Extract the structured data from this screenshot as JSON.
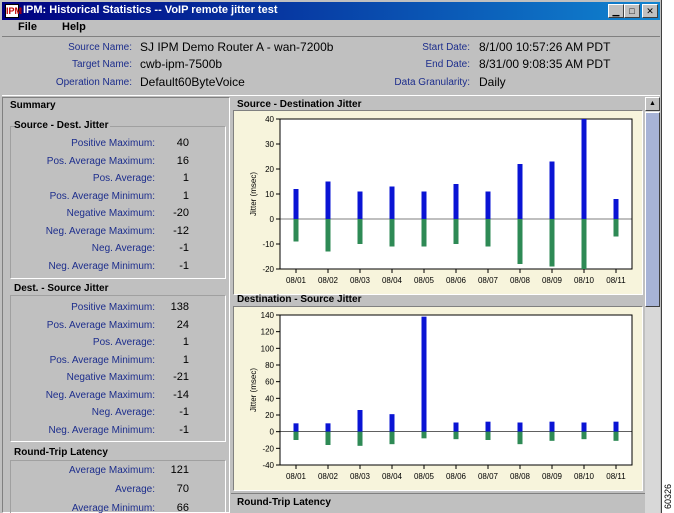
{
  "window": {
    "title": "IPM: Historical Statistics -- VoIP remote jitter test",
    "icon_text": "IPM",
    "controls": [
      "minimize-icon",
      "maximize-icon",
      "close-icon"
    ]
  },
  "menu": [
    {
      "label": "File"
    },
    {
      "label": "Help"
    }
  ],
  "info": {
    "source_name_label": "Source Name:",
    "source_name": "SJ IPM Demo Router A - wan-7200b",
    "target_name_label": "Target Name:",
    "target_name": "cwb-ipm-7500b",
    "operation_name_label": "Operation Name:",
    "operation_name": "Default60ByteVoice",
    "start_date_label": "Start Date:",
    "start_date": "8/1/00 10:57:26 AM PDT",
    "end_date_label": "End Date:",
    "end_date": "8/31/00 9:08:35 AM PDT",
    "granularity_label": "Data Granularity:",
    "granularity": "Daily"
  },
  "summary": {
    "title": "Summary",
    "groups": [
      {
        "title": "Source - Dest. Jitter",
        "rows": [
          {
            "label": "Positive Maximum:",
            "value": "40"
          },
          {
            "label": "Pos. Average Maximum:",
            "value": "16"
          },
          {
            "label": "Pos. Average:",
            "value": "1"
          },
          {
            "label": "Pos. Average Minimum:",
            "value": "1"
          },
          {
            "label": "Negative Maximum:",
            "value": "-20"
          },
          {
            "label": "Neg. Average Maximum:",
            "value": "-12"
          },
          {
            "label": "Neg. Average:",
            "value": "-1"
          },
          {
            "label": "Neg. Average Minimum:",
            "value": "-1"
          }
        ]
      },
      {
        "title": "Dest. - Source Jitter",
        "rows": [
          {
            "label": "Positive Maximum:",
            "value": "138"
          },
          {
            "label": "Pos. Average Maximum:",
            "value": "24"
          },
          {
            "label": "Pos. Average:",
            "value": "1"
          },
          {
            "label": "Pos. Average Minimum:",
            "value": "1"
          },
          {
            "label": "Negative Maximum:",
            "value": "-21"
          },
          {
            "label": "Neg. Average Maximum:",
            "value": "-14"
          },
          {
            "label": "Neg. Average:",
            "value": "-1"
          },
          {
            "label": "Neg. Average Minimum:",
            "value": "-1"
          }
        ]
      },
      {
        "title": "Round-Trip Latency",
        "rows": [
          {
            "label": "Average Maximum:",
            "value": "121"
          },
          {
            "label": "Average:",
            "value": "70"
          },
          {
            "label": "Average Minimum:",
            "value": "66"
          }
        ]
      }
    ]
  },
  "charts_titles": {
    "c1": "Source - Destination Jitter",
    "c2": "Destination - Source Jitter",
    "c3": "Round-Trip Latency"
  },
  "colors": {
    "positive": "#0a14d4",
    "negative": "#2e8a55",
    "plot_bg": "#ffffff",
    "frame_bg": "#f7f4dc",
    "label_blue": "#1c2d8c"
  },
  "side_id": "60326",
  "chart_data": [
    {
      "type": "bar",
      "title": "Source - Destination Jitter",
      "xlabel": "",
      "ylabel": "Jitter (msec)",
      "ylim": [
        -20,
        40
      ],
      "yticks": [
        -20,
        -10,
        0,
        10,
        20,
        30,
        40
      ],
      "categories": [
        "08/01",
        "08/02",
        "08/03",
        "08/04",
        "08/05",
        "08/06",
        "08/07",
        "08/08",
        "08/09",
        "08/10",
        "08/11"
      ],
      "series": [
        {
          "values": [
            12,
            15,
            11,
            13,
            11,
            14,
            11,
            22,
            23,
            40,
            8
          ]
        },
        {
          "values": [
            -9,
            -13,
            -10,
            -11,
            -11,
            -10,
            -11,
            -18,
            -19,
            -20,
            -7
          ]
        }
      ],
      "grid": false,
      "legend": "none"
    },
    {
      "type": "bar",
      "title": "Destination - Source Jitter",
      "xlabel": "",
      "ylabel": "Jitter (msec)",
      "ylim": [
        -40,
        140
      ],
      "yticks": [
        -40,
        -20,
        0,
        20,
        40,
        60,
        80,
        100,
        120,
        140
      ],
      "categories": [
        "08/01",
        "08/02",
        "08/03",
        "08/04",
        "08/05",
        "08/06",
        "08/07",
        "08/08",
        "08/09",
        "08/10",
        "08/11"
      ],
      "series": [
        {
          "values": [
            10,
            10,
            26,
            21,
            138,
            11,
            12,
            11,
            12,
            11,
            12
          ]
        },
        {
          "values": [
            -10,
            -16,
            -17,
            -15,
            -8,
            -9,
            -10,
            -15,
            -11,
            -9,
            -11
          ]
        }
      ],
      "grid": false,
      "legend": "none"
    }
  ]
}
